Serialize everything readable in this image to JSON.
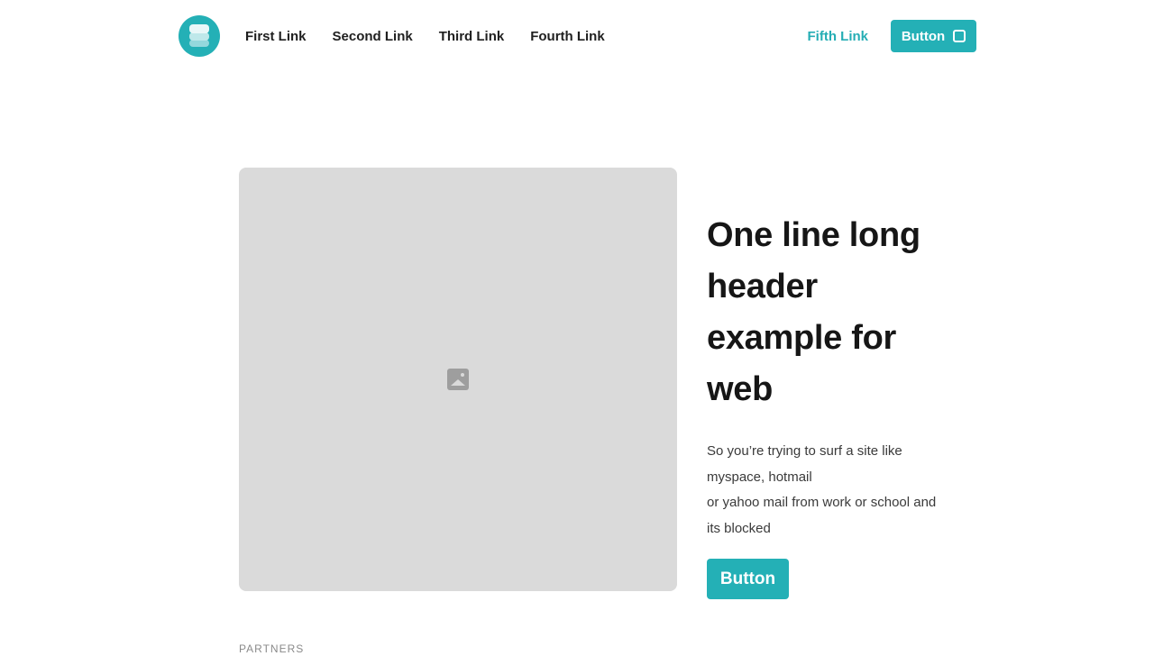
{
  "header": {
    "logo_icon": "stacked-layers-logo-icon",
    "nav": [
      {
        "label": "First Link"
      },
      {
        "label": "Second Link"
      },
      {
        "label": "Third Link"
      },
      {
        "label": "Fourth Link"
      }
    ],
    "fifth_link": "Fifth Link",
    "button_label": "Button",
    "button_icon": "rounded-square-icon"
  },
  "hero": {
    "image_icon": "image-placeholder-icon",
    "title": "One line long header example for web",
    "body": "So you’re trying to surf a site like myspace, hotmail\nor yahoo mail from work or school and its blocked",
    "button_label": "Button"
  },
  "partners_label": "PARTNERS",
  "colors": {
    "accent": "#24b0b6",
    "placeholder": "#dadada",
    "text": "#1a1a1a"
  }
}
